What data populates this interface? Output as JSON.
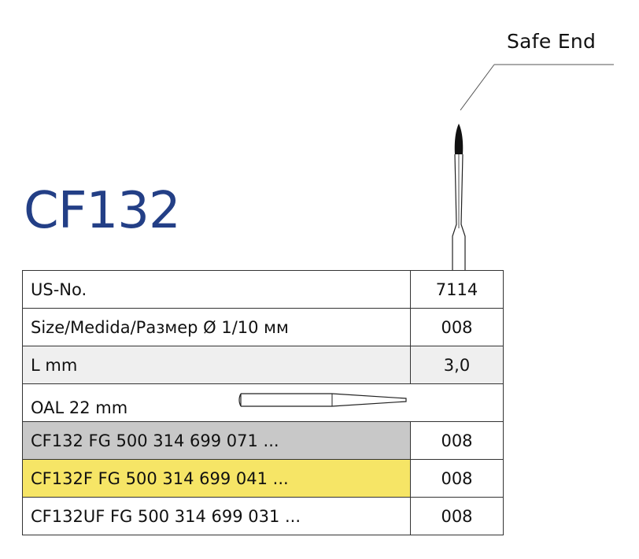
{
  "safe_end_label": "Safe End",
  "product_code": "CF132",
  "product_code_color": "#233f86",
  "table": {
    "rows": [
      {
        "label": "US-No.",
        "value": "7114",
        "shade": "none"
      },
      {
        "label": "Size/Medida/Размер Ø 1/10 мм",
        "value": "008",
        "shade": "none"
      },
      {
        "label": "L mm",
        "value": "3,0",
        "shade": "light-grey"
      },
      {
        "label": "OAL  22 mm",
        "value": "",
        "shade": "none",
        "icon": "bur-outline-icon"
      },
      {
        "label": "CF132 FG 500 314 699 071 ...",
        "value": "008",
        "shade": "grey"
      },
      {
        "label": "CF132F FG 500 314 699 041 ...",
        "value": "008",
        "shade": "yellow"
      },
      {
        "label": "CF132UF FG 500 314 699 031 ...",
        "value": "008",
        "shade": "none"
      }
    ]
  },
  "colors": {
    "grey_row": "#c8c8c8",
    "yellow_row": "#f6e566",
    "light_row": "#efefef"
  }
}
